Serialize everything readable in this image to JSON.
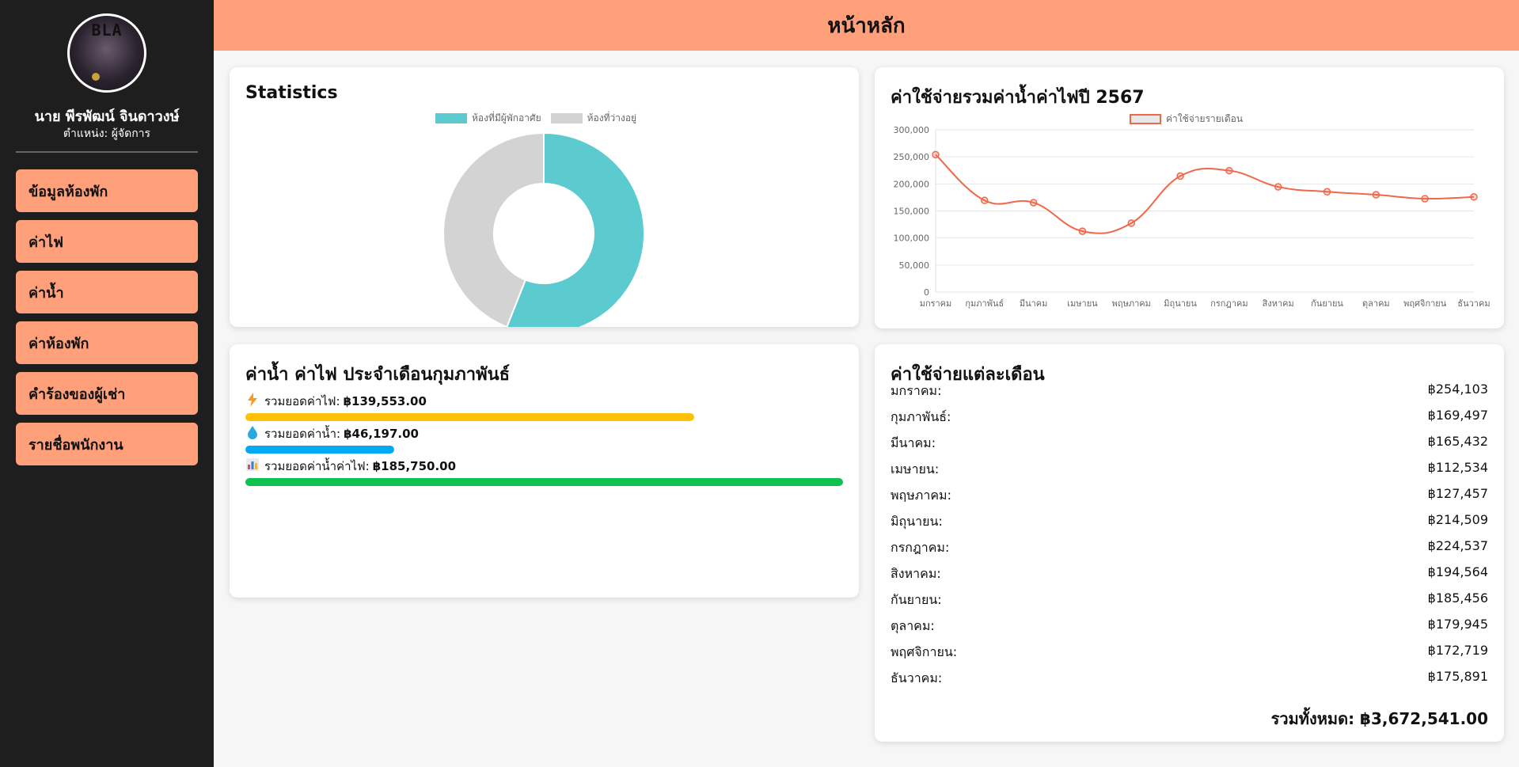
{
  "app": {
    "title": "หน้าหลัก"
  },
  "user": {
    "name": "นาย พีรพัฒน์ จินดาวงษ์",
    "role": "ตำแหน่ง: ผู้จัดการ",
    "avatar_text": "BLA"
  },
  "sidebar": {
    "items": [
      {
        "label": "ข้อมูลห้องพัก"
      },
      {
        "label": "ค่าไฟ"
      },
      {
        "label": "ค่าน้ำ"
      },
      {
        "label": "ค่าห้องพัก"
      },
      {
        "label": "คำร้องของผู้เช่า"
      },
      {
        "label": "รายชื่อพนักงาน"
      }
    ]
  },
  "stats": {
    "title": "Statistics",
    "legend": [
      "ห้องที่มีผู้พักอาศัย",
      "ห้องที่ว่างอยู่"
    ]
  },
  "expense_chart": {
    "title": "ค่าใช้จ่ายรวมค่าน้ำค่าไฟปี 2567"
  },
  "utility": {
    "title": "ค่าน้ำ ค่าไฟ ประจำเดือนกุมภาพันธ์",
    "electric": {
      "label": "รวมยอดค่าไฟ:",
      "value": "฿139,553.00",
      "icon": "lightning-icon"
    },
    "water": {
      "label": "รวมยอดค่าน้ำ:",
      "value": "฿46,197.00",
      "icon": "water-drop-icon"
    },
    "total": {
      "label": "รวมยอดค่าน้ำค่าไฟ:",
      "value": "฿185,750.00",
      "icon": "bar-chart-icon"
    }
  },
  "monthly": {
    "title": "ค่าใช้จ่ายแต่ละเดือน",
    "rows": [
      {
        "month": "มกราคม:",
        "amount": "฿254,103"
      },
      {
        "month": "กุมภาพันธ์:",
        "amount": "฿169,497"
      },
      {
        "month": "มีนาคม:",
        "amount": "฿165,432"
      },
      {
        "month": "เมษายน:",
        "amount": "฿112,534"
      },
      {
        "month": "พฤษภาคม:",
        "amount": "฿127,457"
      },
      {
        "month": "มิถุนายน:",
        "amount": "฿214,509"
      },
      {
        "month": "กรกฎาคม:",
        "amount": "฿224,537"
      },
      {
        "month": "สิงหาคม:",
        "amount": "฿194,564"
      },
      {
        "month": "กันยายน:",
        "amount": "฿185,456"
      },
      {
        "month": "ตุลาคม:",
        "amount": "฿179,945"
      },
      {
        "month": "พฤศจิกายน:",
        "amount": "฿172,719"
      },
      {
        "month": "ธันวาคม:",
        "amount": "฿175,891"
      }
    ],
    "total": "รวมทั้งหมด: ฿3,672,541.00"
  },
  "colors": {
    "accent": "#ffa07a",
    "sidebar_bg": "#1e1e1e",
    "occupied": "#5bcbcf",
    "vacant": "#d3d3d3",
    "line": "#f0684a",
    "electric_bar": "#ffc107",
    "water_bar": "#03a9f4",
    "total_bar": "#0fc150"
  },
  "chart_data": [
    {
      "type": "pie",
      "labels": [
        "ห้องที่มีผู้พักอาศัย",
        "ห้องที่ว่างอยู่"
      ],
      "values": [
        56,
        44
      ],
      "legend": "top"
    },
    {
      "type": "line",
      "categories": [
        "มกราคม",
        "กุมภาพันธ์",
        "มีนาคม",
        "เมษายน",
        "พฤษภาคม",
        "มิถุนายน",
        "กรกฎาคม",
        "สิงหาคม",
        "กันยายน",
        "ตุลาคม",
        "พฤศจิกายน",
        "ธันวาคม"
      ],
      "series": [
        {
          "name": "ค่าใช้จ่ายรายเดือน",
          "values": [
            254103,
            169497,
            165432,
            112534,
            127457,
            214509,
            224537,
            194564,
            185456,
            179945,
            172719,
            175891
          ]
        }
      ],
      "ylim": [
        0,
        300000
      ],
      "yticks": [
        "0",
        "50,000",
        "100,000",
        "150,000",
        "200,000",
        "250,000",
        "300,000"
      ],
      "grid": true,
      "legend": "top"
    },
    {
      "type": "bar",
      "orientation": "horizontal",
      "categories": [
        "รวมยอดค่าไฟ:",
        "รวมยอดค่าน้ำ:",
        "รวมยอดค่าน้ำค่าไฟ:"
      ],
      "values": [
        139553,
        46197,
        185750
      ]
    }
  ]
}
